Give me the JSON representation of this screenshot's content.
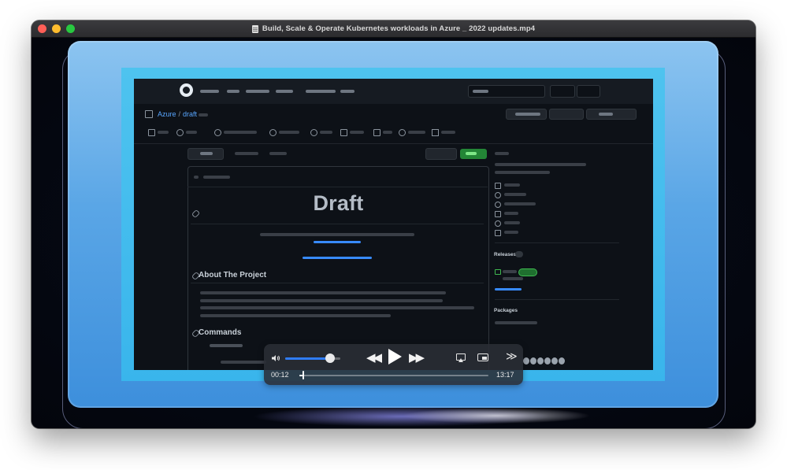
{
  "window": {
    "title": "Build, Scale & Operate Kubernetes workloads in Azure _ 2022 updates.mp4"
  },
  "repo": {
    "owner": "Azure",
    "separator": "/",
    "name": "draft"
  },
  "readme": {
    "title": "Draft",
    "sections": [
      {
        "heading": "About The Project"
      },
      {
        "heading": "Commands"
      }
    ]
  },
  "sidebar": {
    "releases_heading": "Releases",
    "packages_heading": "Packages"
  },
  "playback": {
    "current_time": "00:12",
    "total_time": "13:17",
    "progress": 0.015,
    "volume": 0.82,
    "state": "paused"
  },
  "colors": {
    "accent": "#2f7cf6",
    "gh_link": "#58a6ff",
    "gh_bg": "#0d1117",
    "frame_blue": "#5aa6e6",
    "frame_cyan": "#39b5ec",
    "green": "#238636"
  },
  "icons": {
    "volume": "speaker-icon",
    "rewind": "rewind-icon",
    "play": "play-icon",
    "fast_forward": "fast-forward-icon",
    "airplay": "airplay-icon",
    "pip": "picture-in-picture-icon",
    "share": "share-icon"
  }
}
